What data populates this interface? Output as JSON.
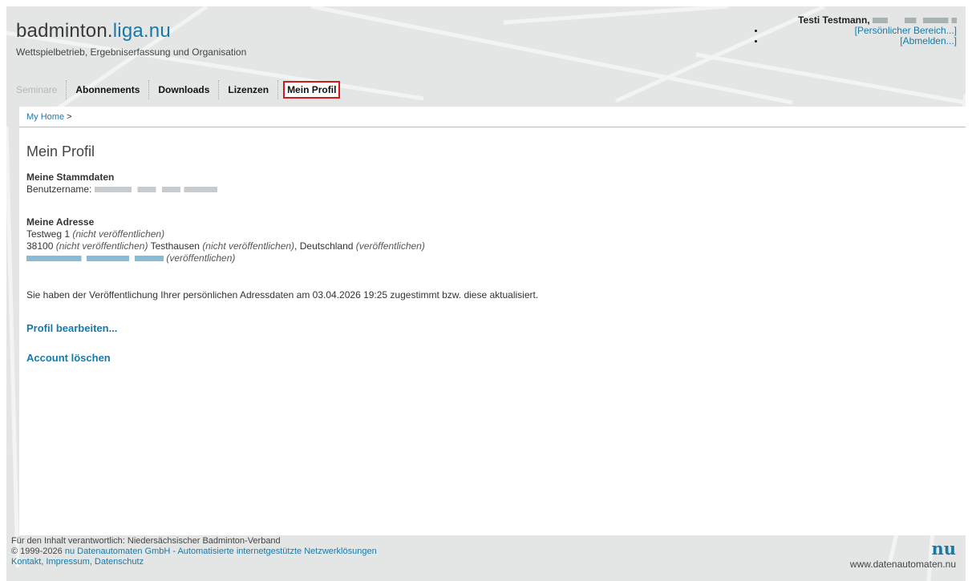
{
  "site": {
    "logo_main": "badminton.",
    "logo_accent": "liga.nu",
    "tagline": "Wettspielbetrieb, Ergebniserfassung und Organisation"
  },
  "user": {
    "name": "Testi Testmann,",
    "links": [
      "[Persönlicher Bereich...]",
      "[Abmelden...]"
    ]
  },
  "nav": {
    "items": [
      {
        "label": "Seminare",
        "state": "disabled"
      },
      {
        "label": "Abonnements",
        "state": "normal"
      },
      {
        "label": "Downloads",
        "state": "normal"
      },
      {
        "label": "Lizenzen",
        "state": "normal"
      },
      {
        "label": "Mein Profil",
        "state": "active"
      }
    ]
  },
  "breadcrumb": {
    "home": "My Home",
    "separator": ">"
  },
  "page": {
    "title": "Mein Profil",
    "stammdaten": {
      "heading": "Meine Stammdaten",
      "username_label": "Benutzername:"
    },
    "adresse": {
      "heading": "Meine Adresse",
      "street": "Testweg 1",
      "street_note": "(nicht veröffentlichen)",
      "zip": "38100",
      "zip_note": "(nicht veröffentlichen)",
      "city": "Testhausen",
      "city_note": "(nicht veröffentlichen)",
      "comma": ",",
      "country": "Deutschland",
      "country_note": "(veröffentlichen)",
      "email_note": "(veröffentlichen)"
    },
    "consent": "Sie haben der Veröffentlichung Ihrer persönlichen Adressdaten  am 03.04.2026 19:25 zugestimmt bzw. diese aktualisiert.",
    "edit_link": "Profil bearbeiten...",
    "delete_link": "Account löschen"
  },
  "footer": {
    "line1": "Für den Inhalt verantwortlich: Niedersächsischer Badminton-Verband",
    "line2_prefix": "© 1999-2026 ",
    "line2_link": "nu Datenautomaten GmbH - Automatisierte internetgestützte Netzwerklösungen",
    "line3": "Kontakt, Impressum, Datenschutz",
    "brand": "nu",
    "brand_url": "www.datenautomaten.nu"
  },
  "colors": {
    "link": "#1879a8",
    "active_outline": "#d11a1a",
    "header_bg": "#e4e6e5"
  }
}
